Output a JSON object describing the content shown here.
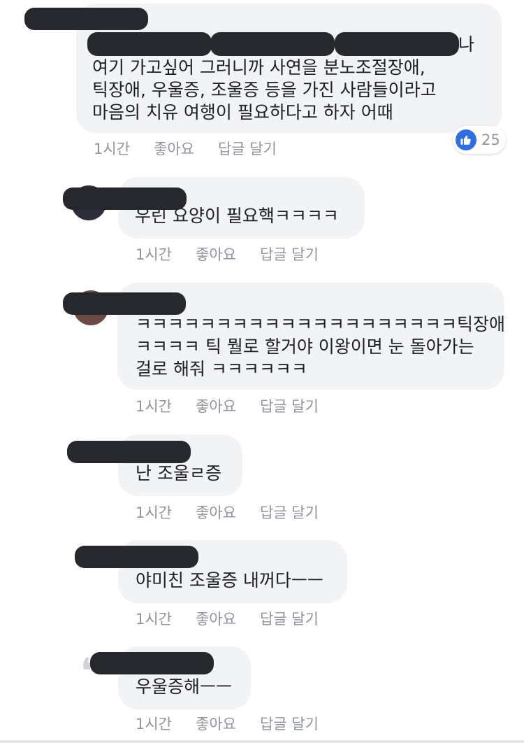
{
  "comments": [
    {
      "text_line1_tail": "나",
      "text_rest": "여기 가고싶어 그러니까 사연을 분노조절장애,\n틱장애, 우울증, 조울증 등을 가진 사람들이라고\n마음의 치유 여행이 필요하다고 하자 어때",
      "time": "1시간",
      "like": "좋아요",
      "reply": "답글 달기",
      "reaction_count": "25"
    },
    {
      "text": "우린 요양이 필요핵ㅋㅋㅋㅋ",
      "time": "1시간",
      "like": "좋아요",
      "reply": "답글 달기"
    },
    {
      "text": "ㅋㅋㅋㅋㅋㅋㅋㅋㅋㅋㅋㅋㅋㅋㅋㅋㅋㅋㅋㅋ틱장애\nㅋㅋㅋㅋ 틱 뭘로 할거야 이왕이면 눈 돌아가는\n걸로 해줘 ㅋㅋㅋㅋㅋㅋ",
      "time": "1시간",
      "like": "좋아요",
      "reply": "답글 달기"
    },
    {
      "text": "난 조울ㄹ증",
      "time": "1시간",
      "like": "좋아요",
      "reply": "답글 달기"
    },
    {
      "text": "야미친 조울증 내꺼다ㅡㅡ",
      "time": "1시간",
      "like": "좋아요",
      "reply": "답글 달기"
    },
    {
      "text": "우울증해ㅡㅡ",
      "time": "1시간",
      "like": "좋아요",
      "reply": "답글 달기"
    }
  ],
  "icons": {
    "like_reaction": "thumbs-up-icon",
    "avatar_placeholder": "quote-icon"
  },
  "colors": {
    "bubble": "#f2f3f5",
    "meta": "#90949c",
    "like_blue": "#2f6fe0",
    "redaction": "#26282d"
  }
}
